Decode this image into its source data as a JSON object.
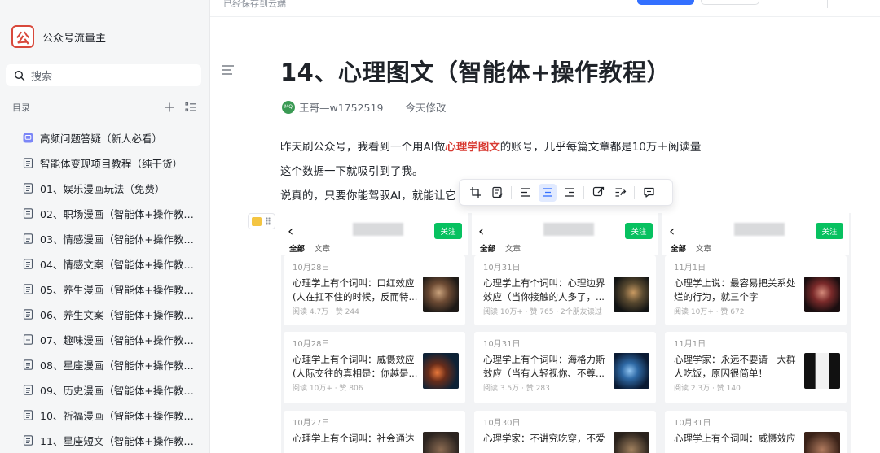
{
  "app": {
    "name": "公众号流量主",
    "logo_char": "公",
    "save_status": "已经保存到云端"
  },
  "sidebar": {
    "search_placeholder": "搜索",
    "toc_title": "目录",
    "items": [
      {
        "label": "高频问题答疑（新人必看）",
        "icon": "chat-doc-icon"
      },
      {
        "label": "智能体变现项目教程（纯干货）",
        "icon": "doc-icon"
      },
      {
        "label": "01、娱乐漫画玩法（免费）",
        "icon": "doc-icon"
      },
      {
        "label": "02、职场漫画（智能体+操作教程）",
        "icon": "doc-icon"
      },
      {
        "label": "03、情感漫画（智能体+操作教程）",
        "icon": "doc-icon"
      },
      {
        "label": "04、情感文案（智能体+操作教程）",
        "icon": "doc-icon"
      },
      {
        "label": "05、养生漫画（智能体+操作教程...",
        "icon": "doc-icon"
      },
      {
        "label": "06、养生文案（智能体+操作教程）",
        "icon": "doc-icon"
      },
      {
        "label": "07、趣味漫画（智能体+操作教程）",
        "icon": "doc-icon"
      },
      {
        "label": "08、星座漫画（智能体+操作教程）",
        "icon": "doc-icon"
      },
      {
        "label": "09、历史漫画（智能体+操作教程）",
        "icon": "doc-icon"
      },
      {
        "label": "10、祈福漫画（智能体+操作教程）",
        "icon": "doc-icon"
      },
      {
        "label": "11、星座短文（智能体+操作教程）",
        "icon": "doc-icon"
      }
    ]
  },
  "document": {
    "title": "14、心理图文（智能体+操作教程）",
    "author": "王哥—w1752519",
    "avatar_text": "MQ",
    "modified": "今天修改",
    "p1_before": "昨天刷公众号，我看到一个用AI做",
    "p1_highlight": "心理学图文",
    "p1_after": "的账号，几乎每篇文章都是10万＋阅读量",
    "p2": "这个数据一下就吸引到了我。",
    "p3": "说真的，只要你能驾驭AI，就能让它"
  },
  "toolbar": {
    "icons": [
      "crop-icon",
      "note-icon",
      "align-left-icon",
      "align-center-icon",
      "align-right-icon",
      "link-icon",
      "share-icon",
      "comment-icon"
    ],
    "active": "align-center-icon"
  },
  "collage": {
    "follow_label": "关注",
    "tab_all": "全部",
    "tab_articles": "文章",
    "phones": [
      {
        "cards": [
          {
            "date": "10月28日",
            "title": "心理学上有个词叫：口红效应(人在扛不住的时候，反而特...",
            "stats": "阅读 4.7万 · 赞 244"
          },
          {
            "date": "10月28日",
            "title": "心理学上有个词叫：威慑效应(人际交往的真相是：你越是...",
            "stats": "阅读 10万+ · 赞 806"
          },
          {
            "date": "10月27日",
            "title": "心理学上有个词叫：社会通达",
            "stats": ""
          }
        ]
      },
      {
        "cards": [
          {
            "date": "10月31日",
            "title": "心理学上有个词叫：心理边界效应（当你接触的人多了，...",
            "stats": "阅读 10万+ · 赞 765 · 2个朋友读过"
          },
          {
            "date": "10月31日",
            "title": "心理学上有个词叫：海格力斯效应（当有人轻视你、不尊...",
            "stats": "阅读 3.5万 · 赞 283"
          },
          {
            "date": "10月30日",
            "title": "心理学家：不讲究吃穿，不爱",
            "stats": ""
          }
        ]
      },
      {
        "cards": [
          {
            "date": "11月1日",
            "title": "心理学上说：最容易把关系处烂的行为，就三个字",
            "stats": "阅读 10万+ · 赞 672"
          },
          {
            "date": "11月1日",
            "title": "心理学家：永远不要请一大群人吃饭，原因很简单！",
            "stats": "阅读 2.3万 · 赞 140"
          },
          {
            "date": "10月31日",
            "title": "心理学上有个词叫：威慑效应",
            "stats": ""
          }
        ]
      }
    ]
  },
  "colors": {
    "accent": "#3370ff",
    "highlight": "#d83931",
    "follow_green": "#07c160",
    "logo_red": "#d8483b"
  }
}
